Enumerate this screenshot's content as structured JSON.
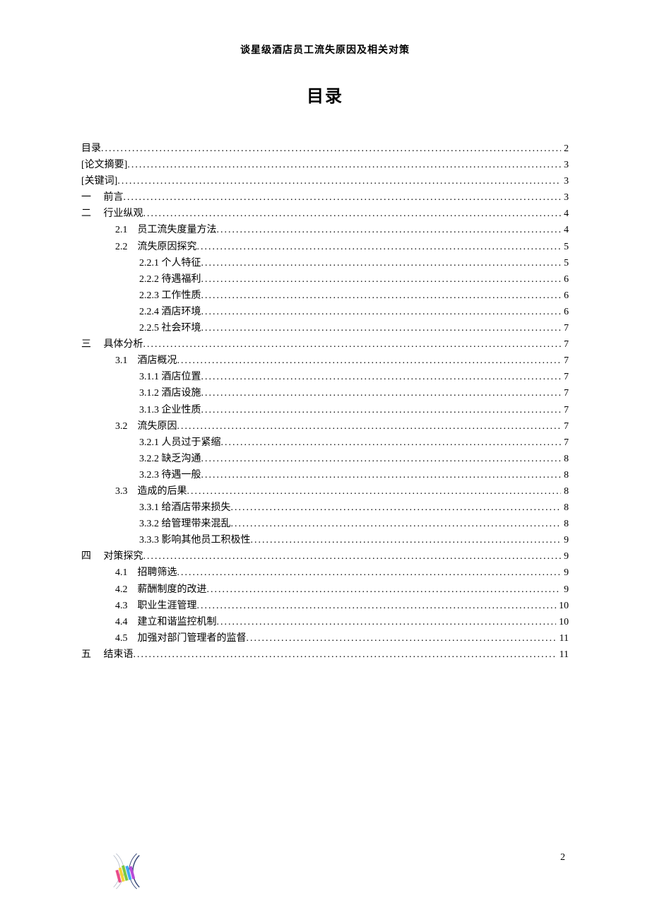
{
  "header": "谈星级酒店员工流失原因及相关对策",
  "toc_title": "目录",
  "page_number": "2",
  "entries": [
    {
      "indent": 0,
      "label": "目录",
      "page": "2"
    },
    {
      "indent": 0,
      "label": "[论文摘要]",
      "page": "3"
    },
    {
      "indent": 0,
      "label": "[关键词]",
      "page": "3"
    },
    {
      "indent": 0,
      "label": "一　 前言",
      "page": "3"
    },
    {
      "indent": 0,
      "label": "二　 行业纵观",
      "page": "4"
    },
    {
      "indent": 1,
      "label": "2.1　员工流失度量方法",
      "page": "4"
    },
    {
      "indent": 1,
      "label": "2.2　流失原因探究",
      "page": "5"
    },
    {
      "indent": 2,
      "label": "2.2.1 个人特征",
      "page": "5"
    },
    {
      "indent": 2,
      "label": "2.2.2 待遇福利",
      "page": "6"
    },
    {
      "indent": 2,
      "label": "2.2.3 工作性质",
      "page": "6"
    },
    {
      "indent": 2,
      "label": "2.2.4 酒店环境",
      "page": "6"
    },
    {
      "indent": 2,
      "label": "2.2.5 社会环境",
      "page": "7"
    },
    {
      "indent": 0,
      "label": "三　 具体分析",
      "page": "7"
    },
    {
      "indent": 1,
      "label": "3.1　酒店概况",
      "page": "7"
    },
    {
      "indent": 2,
      "label": "3.1.1 酒店位置",
      "page": "7"
    },
    {
      "indent": 2,
      "label": "3.1.2 酒店设施",
      "page": "7"
    },
    {
      "indent": 2,
      "label": "3.1.3 企业性质",
      "page": "7"
    },
    {
      "indent": 1,
      "label": "3.2　流失原因",
      "page": "7"
    },
    {
      "indent": 2,
      "label": "3.2.1 人员过于紧缩",
      "page": "7"
    },
    {
      "indent": 2,
      "label": "3.2.2 缺乏沟通",
      "page": "8"
    },
    {
      "indent": 2,
      "label": "3.2.3 待遇一般",
      "page": "8"
    },
    {
      "indent": 1,
      "label": "3.3　造成的后果",
      "page": "8"
    },
    {
      "indent": 2,
      "label": "3.3.1 给酒店带来损失",
      "page": "8"
    },
    {
      "indent": 2,
      "label": "3.3.2 给管理带来混乱",
      "page": "8"
    },
    {
      "indent": 2,
      "label": "3.3.3 影响其他员工积极性",
      "page": "9"
    },
    {
      "indent": 0,
      "label": "四　 对策探究",
      "page": "9"
    },
    {
      "indent": 1,
      "label": "4.1　招聘筛选",
      "page": "9"
    },
    {
      "indent": 1,
      "label": "4.2　薪酬制度的改进",
      "page": "9"
    },
    {
      "indent": 1,
      "label": "4.3　职业生涯管理",
      "page": "10"
    },
    {
      "indent": 1,
      "label": "4.4　建立和谐监控机制",
      "page": "10"
    },
    {
      "indent": 1,
      "label": "4.5　加强对部门管理者的监督",
      "page": "11"
    },
    {
      "indent": 0,
      "label": "五　 结束语",
      "page": "11"
    }
  ]
}
